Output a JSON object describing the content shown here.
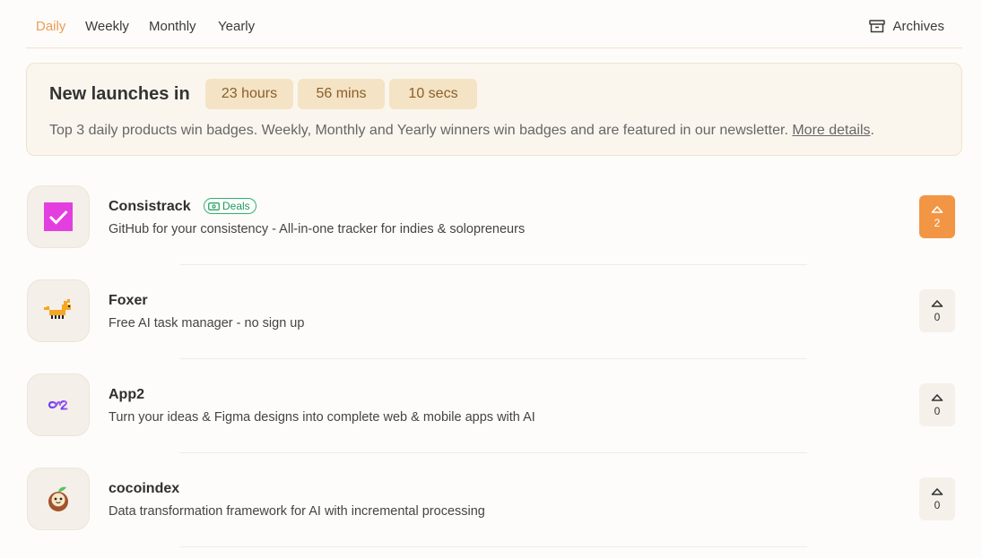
{
  "tabs": [
    {
      "label": "Daily",
      "active": true
    },
    {
      "label": "Weekly",
      "active": false
    },
    {
      "label": "Monthly",
      "active": false
    },
    {
      "label": "Yearly",
      "active": false
    }
  ],
  "archives": {
    "label": "Archives",
    "icon": "archive-box-icon"
  },
  "banner": {
    "title": "New launches in",
    "countdown": {
      "hours": "23 hours",
      "mins": "56 mins",
      "secs": "10 secs"
    },
    "description": "Top 3 daily products win badges. Weekly, Monthly and Yearly winners win badges and are featured in our newsletter.",
    "link": "More details",
    "trailing": "."
  },
  "products": [
    {
      "name": "Consistrack",
      "tagline": "GitHub for your consistency - All-in-one tracker for indies & solopreneurs",
      "badge": "Deals",
      "votes": "2",
      "voted": true
    },
    {
      "name": "Foxer",
      "tagline": "Free AI task manager - no sign up",
      "votes": "0",
      "voted": false
    },
    {
      "name": "App2",
      "tagline": "Turn your ideas & Figma designs into complete web & mobile apps with AI",
      "votes": "0",
      "voted": false
    },
    {
      "name": "cocoindex",
      "tagline": "Data transformation framework for AI with incremental processing",
      "votes": "0",
      "voted": false
    }
  ],
  "colors": {
    "accent": "#ee9c52",
    "vote_active": "#f29645",
    "deals_green": "#2db36a",
    "pill_bg": "#f4e3c4"
  }
}
